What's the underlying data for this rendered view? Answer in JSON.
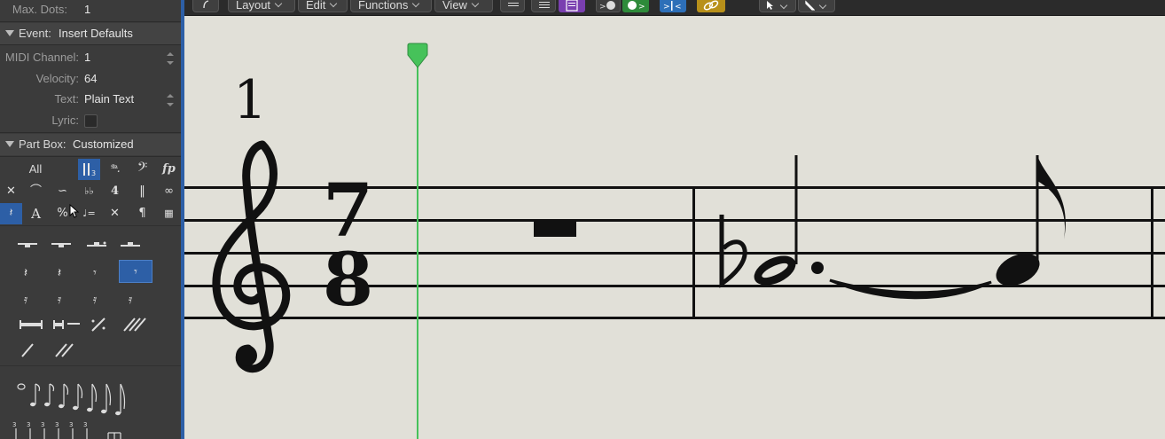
{
  "inspector": {
    "max_dots": {
      "label": "Max. Dots:",
      "value": "1"
    },
    "event_header": {
      "label": "Event:",
      "value": "Insert Defaults"
    },
    "midi_channel": {
      "label": "MIDI Channel:",
      "value": "1"
    },
    "velocity": {
      "label": "Velocity:",
      "value": "64"
    },
    "text": {
      "label": "Text:",
      "value": "Plain Text"
    },
    "lyric": {
      "label": "Lyric:",
      "checked": false
    },
    "part_box_header": {
      "label": "Part Box:",
      "value": "Customized"
    },
    "part_box_tabs": [
      "All",
      "𝄪",
      "𝆮.",
      "𝄢",
      "fp"
    ],
    "part_box_icon_rows": [
      [
        "✕",
        "⌒",
        "∽",
        "♭♭",
        "4",
        "‖",
        "∞"
      ],
      [
        "𝄽",
        "A",
        "%",
        "♩=",
        "✕",
        "¶",
        "▦"
      ]
    ]
  },
  "toolbar": {
    "menus": [
      "Layout",
      "Edit",
      "Functions",
      "View"
    ],
    "colors": {
      "purple": "#7a3fb0",
      "green": "#2e8b3a",
      "blue": "#2d6fb8",
      "gold": "#b8901a"
    }
  },
  "score": {
    "measure_number": "1",
    "time_sig_top": "7",
    "time_sig_bottom": "8",
    "playhead_color": "#46c25a"
  }
}
